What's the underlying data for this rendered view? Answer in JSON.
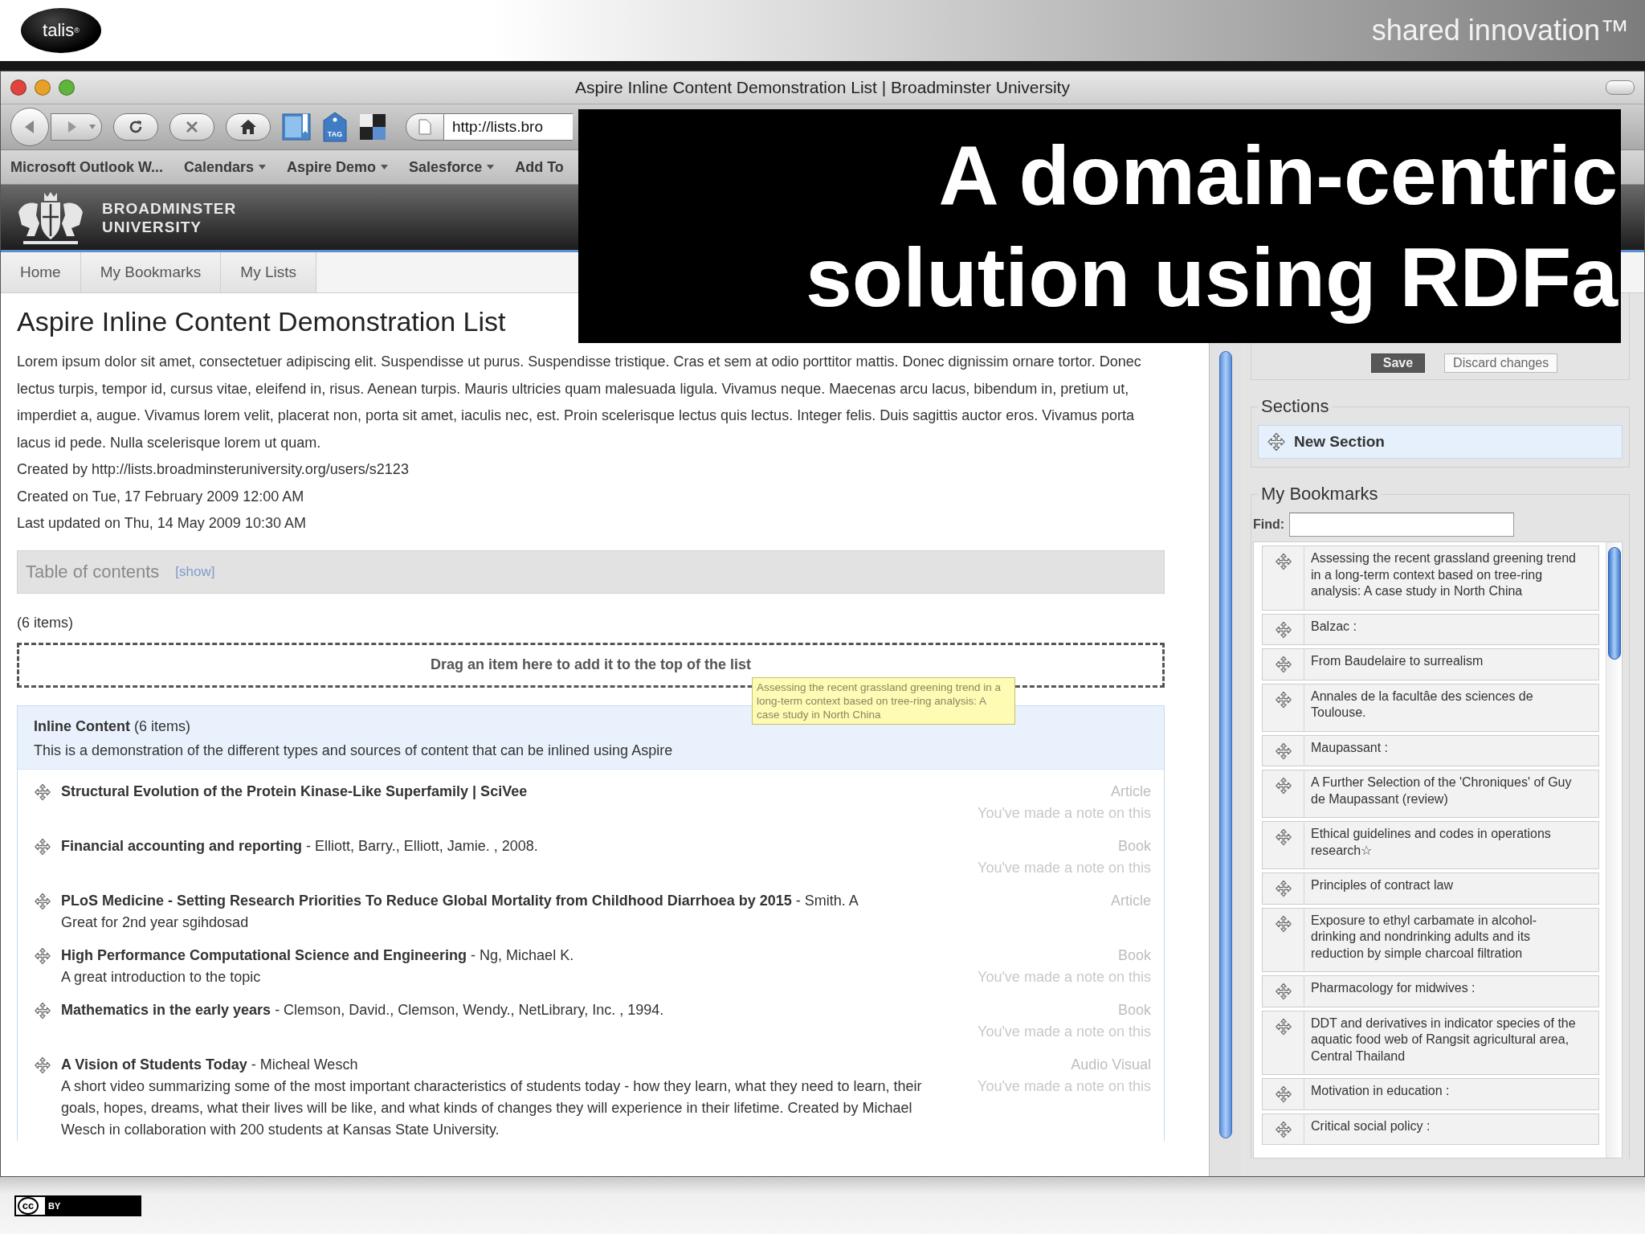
{
  "slide": {
    "logo": "talis$^{®}$",
    "tagline": "shared innovation™",
    "title_lines": [
      "A domain-centric",
      "solution using RDFa"
    ],
    "license": {
      "cc": "cc",
      "by": "BY"
    }
  },
  "browser": {
    "title": "Aspire Inline Content Demonstration List | Broadminster University",
    "tag_icon_text": "TAG",
    "address": "http://lists.bro",
    "bookmarks": [
      {
        "label": "Microsoft Outlook W...",
        "menu": false
      },
      {
        "label": "Calendars",
        "menu": true
      },
      {
        "label": "Aspire Demo",
        "menu": true
      },
      {
        "label": "Salesforce",
        "menu": true
      },
      {
        "label": "Add To",
        "menu": false
      }
    ]
  },
  "site": {
    "name_lines": [
      "BROADMINSTER",
      "UNIVERSITY"
    ],
    "nav": [
      {
        "label": "Home",
        "selected": false
      },
      {
        "label": "My Bookmarks",
        "selected": false
      },
      {
        "label": "My Lists",
        "selected": false
      }
    ]
  },
  "list": {
    "title": "Aspire Inline Content Demonstration List",
    "description": "Lorem ipsum dolor sit amet, consectetuer adipiscing elit. Suspendisse ut purus. Suspendisse tristique. Cras et sem at odio porttitor mattis. Donec dignissim ornare tortor. Donec lectus turpis, tempor id, cursus vitae, eleifend in, risus. Aenean turpis. Mauris ultricies quam malesuada ligula. Vivamus neque. Maecenas arcu lacus, bibendum in, pretium ut, imperdiet a, augue. Vivamus lorem velit, placerat non, porta sit amet, iaculis nec, est. Proin scelerisque lectus quis lectus. Integer felis. Duis sagittis auctor eros. Vivamus porta lacus id pede. Nulla scelerisque lorem ut quam.",
    "meta": [
      "Created by http://lists.broadminsteruniversity.org/users/s2123",
      "Created on Tue, 17 February 2009 12:00 AM",
      "Last updated on Thu, 14 May 2009 10:30 AM"
    ],
    "toc": {
      "label": "Table of contents",
      "toggle": "[show]"
    },
    "count": "(6 items)",
    "drop_zone": "Drag an item here to add it to the top of the list",
    "tooltip": "Assessing the recent grassland greening trend in a long-term context based on tree-ring analysis: A case study in North China",
    "section": {
      "title": "Inline Content",
      "count": "(6 items)",
      "description": "This is a demonstration of the different types and sources of content that can be inlined using Aspire",
      "items": [
        {
          "title": "Structural Evolution of the Protein Kinase-Like Superfamily | SciVee",
          "type": "Article",
          "note_flag": "You've made a note on this"
        },
        {
          "title": "Financial accounting and reporting",
          "author": "- Elliott, Barry., Elliott, Jamie. , 2008.",
          "type": "Book",
          "note_flag": "You've made a note on this"
        },
        {
          "title": "PLoS Medicine - Setting Research Priorities To Reduce Global Mortality from Childhood Diarrhoea by 2015",
          "author": "- Smith. A",
          "note": "Great for 2nd year sgihdosad",
          "type": "Article"
        },
        {
          "title": "High Performance Computational Science and Engineering",
          "author": "- Ng, Michael K.",
          "note": "A great introduction to the topic",
          "type": "Book",
          "note_flag": "You've made a note on this"
        },
        {
          "title": "Mathematics in the early years",
          "author": "- Clemson, David., Clemson, Wendy., NetLibrary, Inc. , 1994.",
          "type": "Book",
          "note_flag": "You've made a note on this"
        },
        {
          "title": "A Vision of Students Today",
          "author": "- Micheal Wesch",
          "note": "A short video summarizing some of the most important characteristics of students today - how they learn, what they need to learn, their goals, hopes, dreams, what their lives will be like, and what kinds of changes they will experience in their lifetime. Created by Michael Wesch in collaboration with 200 students at Kansas State University.",
          "type": "Audio Visual",
          "note_flag": "You've made a note on this"
        }
      ]
    }
  },
  "sidebar": {
    "save": "Save",
    "discard": "Discard changes",
    "sections": {
      "legend": "Sections",
      "items": [
        "New Section"
      ]
    },
    "bookmarks": {
      "legend": "My Bookmarks",
      "find_label": "Find:",
      "items": [
        "Assessing the recent grassland greening trend in a long-term context based on tree-ring analysis: A case study in North China",
        "Balzac :",
        "From Baudelaire to surrealism",
        "Annales de la facultâe des sciences de Toulouse.",
        "Maupassant :",
        "A Further Selection of the 'Chroniques' of Guy de Maupassant (review)",
        "Ethical guidelines and codes in operations research☆",
        "Principles of contract law",
        "Exposure to ethyl carbamate in alcohol-drinking and nondrinking adults and its reduction by simple charcoal filtration",
        "Pharmacology for midwives :",
        "DDT and derivatives in indicator species of the aquatic food web of Rangsit agricultural area, Central Thailand",
        "Motivation in education :",
        "Critical social policy :"
      ]
    }
  }
}
